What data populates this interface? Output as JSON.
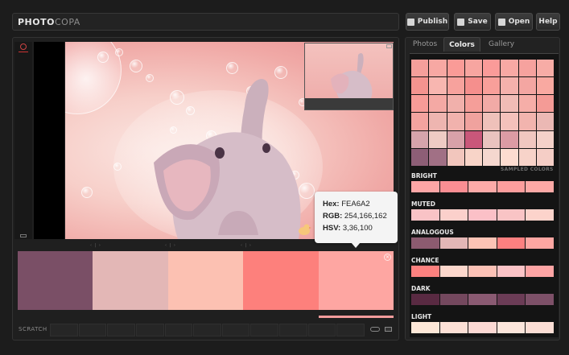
{
  "app": {
    "logo_bold": "PHOTO",
    "logo_thin": "COPA"
  },
  "toolbar": {
    "publish_label": "Publish",
    "save_label": "Save",
    "open_label": "Open",
    "help_label": "Help"
  },
  "tabs": [
    {
      "label": "Photos",
      "active": false
    },
    {
      "label": "Colors",
      "active": true
    },
    {
      "label": "Gallery",
      "active": false
    }
  ],
  "tooltip": {
    "hex_label": "Hex:",
    "hex_value": "FEA6A2",
    "rgb_label": "RGB:",
    "rgb_value": "254,166,162",
    "hsv_label": "HSV:",
    "hsv_value": "3,36,100"
  },
  "palette": [
    "#7a4f66",
    "#e3b7b6",
    "#fcc1b2",
    "#fd807c",
    "#fea6a2"
  ],
  "scratch": {
    "label": "SCRATCH"
  },
  "sampled_label": "SAMPLED COLORS",
  "sampled_grid": [
    "#f59f9b",
    "#f7a8a3",
    "#fa9b97",
    "#f7a5a0",
    "#fa9b99",
    "#f8a9a4",
    "#f6a29e",
    "#f7aca6",
    "#f4938f",
    "#f8b6b0",
    "#f7a29d",
    "#f58f8d",
    "#f89f9a",
    "#f5b1ac",
    "#f4a6a2",
    "#f9a9a1",
    "#f79b97",
    "#f4a9a4",
    "#f1b0ab",
    "#f59e99",
    "#f2aaa6",
    "#f1bcb6",
    "#f6aea8",
    "#f49b96",
    "#f3a39f",
    "#eeb5b0",
    "#f1b2ad",
    "#f0a29e",
    "#efc1ba",
    "#f4c1bb",
    "#f2b4ae",
    "#ebb8b4",
    "#d6a4ac",
    "#eecbc4",
    "#d8a1a9",
    "#c9577a",
    "#e9c3bf",
    "#dc9ba4",
    "#f0c7c0",
    "#f4d1c9",
    "#8d5e76",
    "#a17085",
    "#f2c6bd",
    "#f8d4c8",
    "#f5d7cf",
    "#fcdcd0",
    "#f7d3c9",
    "#f5cec6"
  ],
  "sections": [
    {
      "title": "BRIGHT",
      "colors": [
        "#fda6a6",
        "#fa8e93",
        "#fdaaa8",
        "#fd9e9d",
        "#fda9a6"
      ]
    },
    {
      "title": "MUTED",
      "colors": [
        "#f9c3c6",
        "#fbd0cb",
        "#fbc0c7",
        "#f9c4c5",
        "#fcd3cb"
      ]
    },
    {
      "title": "ANALOGOUS",
      "colors": [
        "#8c5b70",
        "#e3b7b6",
        "#fcc3b5",
        "#fd8080",
        "#fea6a2"
      ]
    },
    {
      "title": "CHANCE",
      "colors": [
        "#fc817f",
        "#fcd7cc",
        "#fcc1b6",
        "#fbc3c6",
        "#fda4a4"
      ]
    },
    {
      "title": "DARK",
      "colors": [
        "#592a42",
        "#74485e",
        "#8a5a72",
        "#6b3c56",
        "#7d5068"
      ]
    },
    {
      "title": "LIGHT",
      "colors": [
        "#fee8d8",
        "#fde0d6",
        "#fdd9d4",
        "#fde6dc",
        "#fcded5"
      ]
    }
  ]
}
